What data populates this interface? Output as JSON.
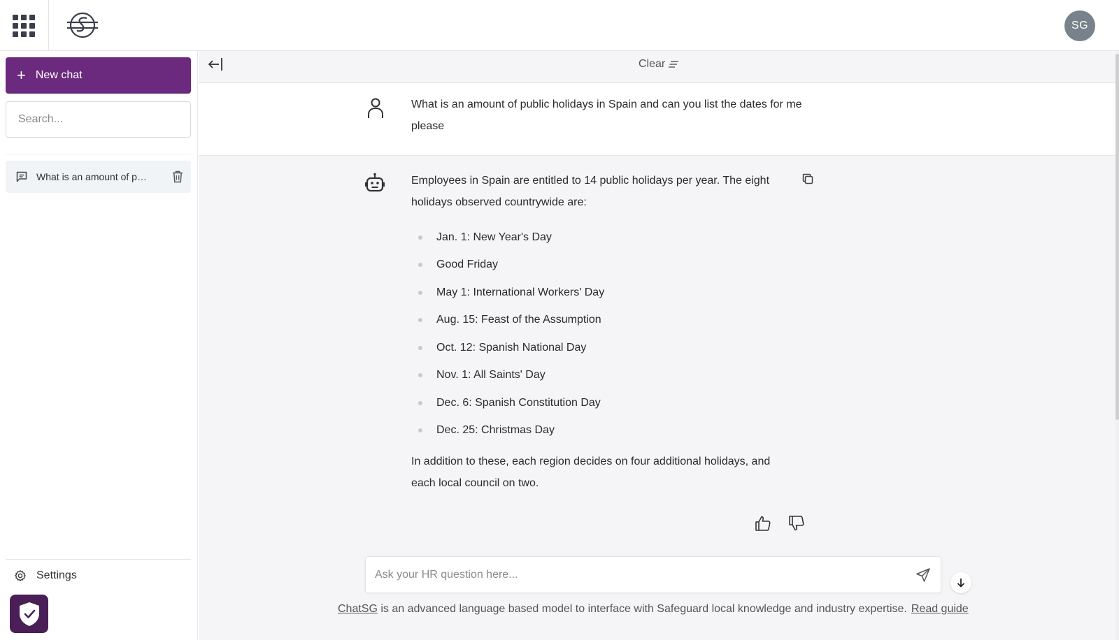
{
  "topbar": {
    "apps_icon": "grid-icon",
    "logo_icon": "sg-logo-icon",
    "avatar_initials": "SG"
  },
  "sidebar": {
    "new_chat_label": "New chat",
    "search_placeholder": "Search...",
    "chat_items": [
      {
        "label": "What is an amount of public holidays in Spain and can you list the dates for me please"
      }
    ],
    "settings_label": "Settings"
  },
  "toolbar": {
    "clear_label": "Clear"
  },
  "conversation": {
    "user_message": "What is an amount of public holidays in Spain and can you list the dates for me please",
    "bot_intro": "Employees in Spain are entitled to 14 public holidays per year. The eight holidays observed countrywide are:",
    "bot_list": [
      "Jan. 1: New Year's Day",
      "Good Friday",
      "May 1: International Workers' Day",
      "Aug. 15: Feast of the Assumption",
      "Oct. 12: Spanish National Day",
      "Nov. 1: All Saints' Day",
      "Dec. 6: Spanish Constitution Day",
      "Dec. 25: Christmas Day"
    ],
    "bot_outro": "In addition to these, each region decides on four additional holidays, and each local council on two."
  },
  "composer": {
    "placeholder": "Ask your HR question here..."
  },
  "footer": {
    "brand_link": "ChatSG",
    "description": " is an advanced language based model to interface with Safeguard local knowledge and industry expertise.",
    "guide_link": "Read guide"
  },
  "colors": {
    "accent": "#6b2a7d",
    "badge": "#4a1f57",
    "avatar": "#77828a"
  }
}
